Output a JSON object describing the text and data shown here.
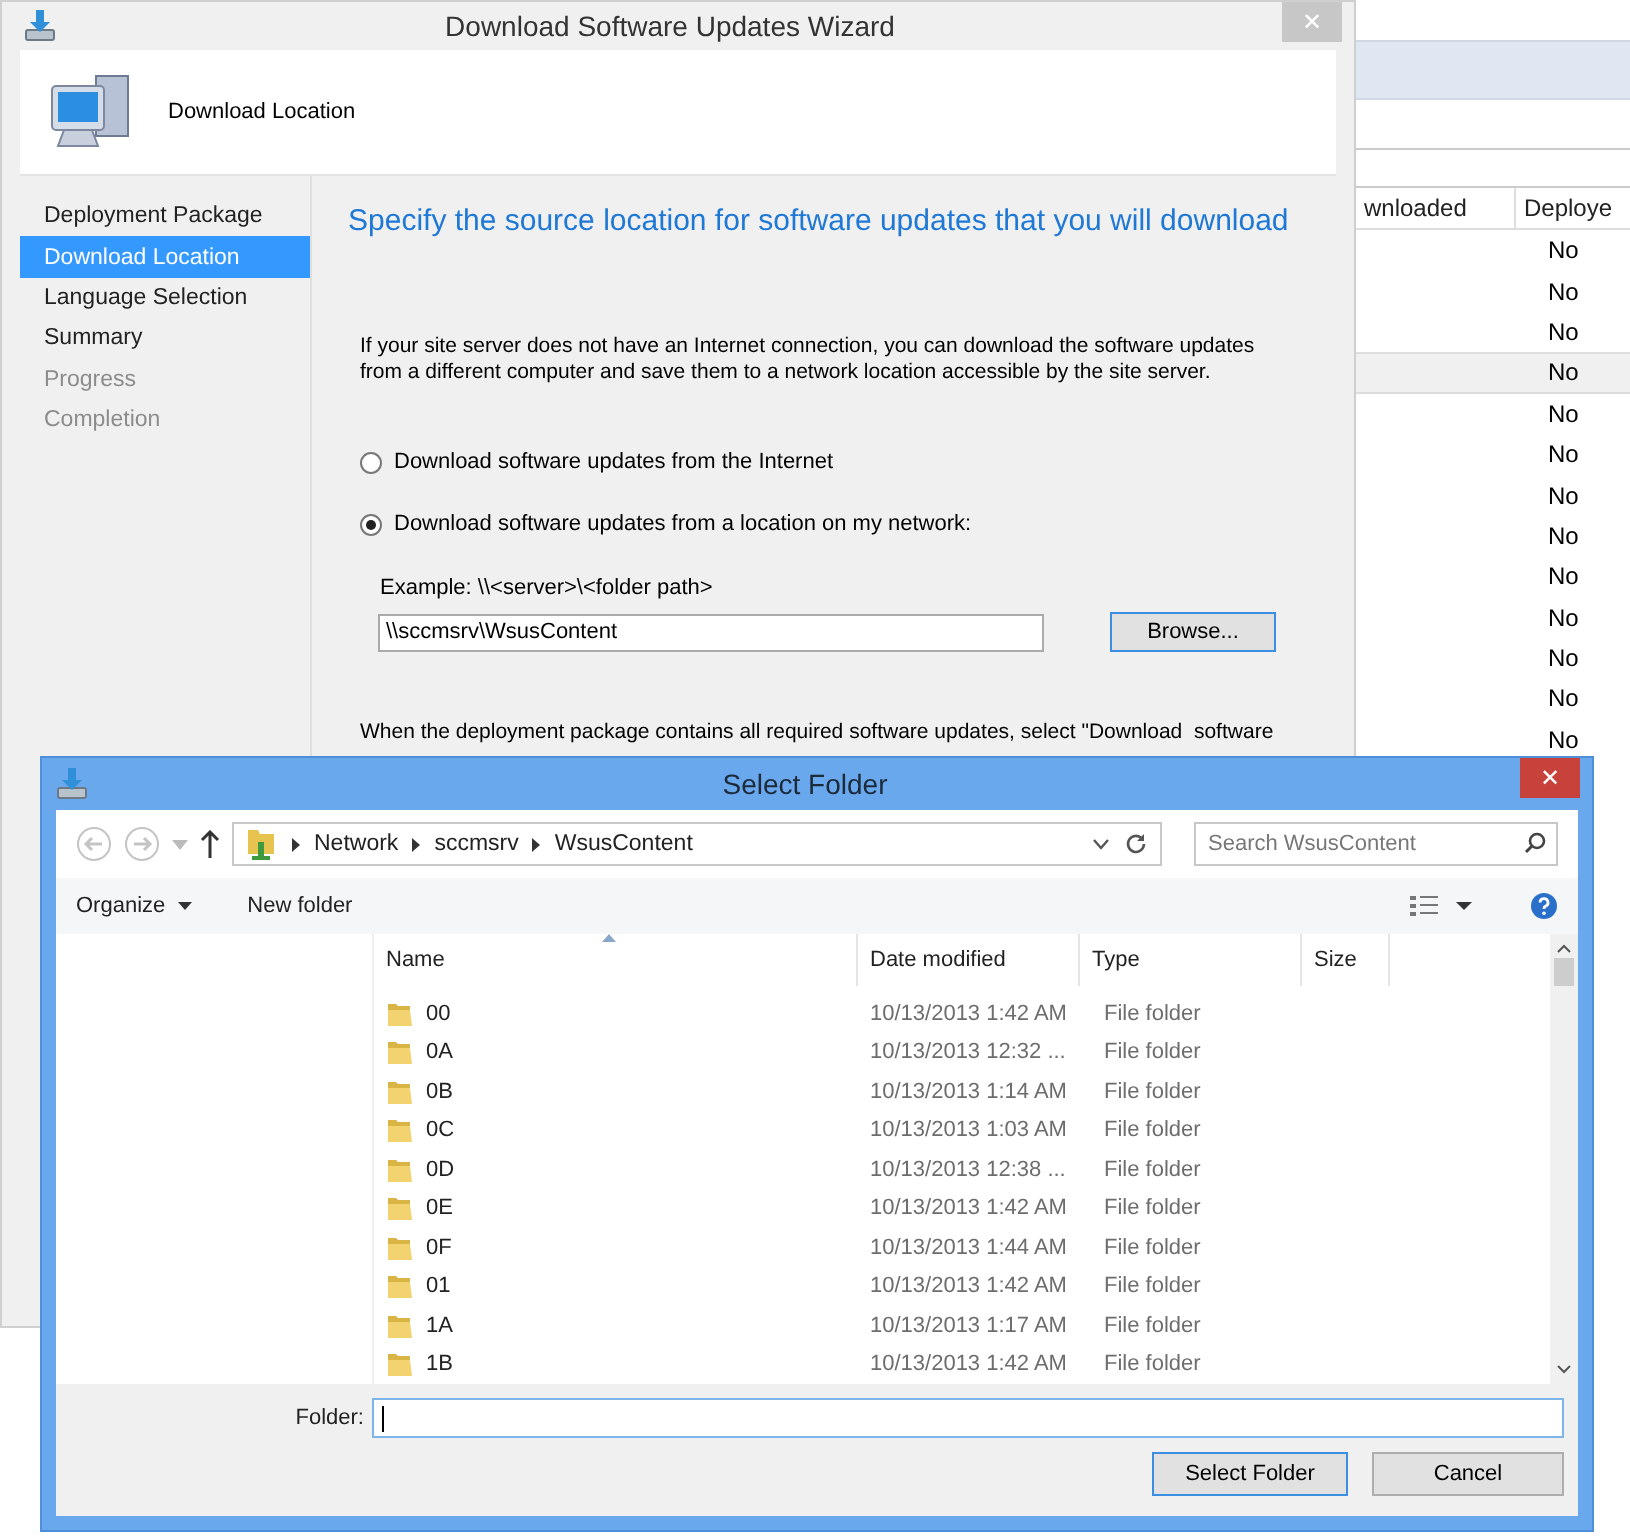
{
  "console": {
    "columns": [
      "wnloaded",
      "Deploye"
    ],
    "rows": [
      {
        "deployed": "No",
        "selected": false
      },
      {
        "deployed": "No",
        "selected": false
      },
      {
        "deployed": "No",
        "selected": false
      },
      {
        "deployed": "No",
        "selected": true
      },
      {
        "deployed": "No",
        "selected": false
      },
      {
        "deployed": "No",
        "selected": false
      },
      {
        "deployed": "No",
        "selected": false
      },
      {
        "deployed": "No",
        "selected": false
      },
      {
        "deployed": "No",
        "selected": false
      },
      {
        "deployed": "No",
        "selected": false
      },
      {
        "deployed": "No",
        "selected": false
      },
      {
        "deployed": "No",
        "selected": false
      },
      {
        "deployed": "No",
        "selected": false
      }
    ]
  },
  "wizard": {
    "title": "Download Software Updates Wizard",
    "close": "✕",
    "page_title": "Download Location",
    "nav": [
      {
        "label": "Deployment Package",
        "selected": false,
        "disabled": false
      },
      {
        "label": "Download Location",
        "selected": true,
        "disabled": false
      },
      {
        "label": "Language Selection",
        "selected": false,
        "disabled": false
      },
      {
        "label": "Summary",
        "selected": false,
        "disabled": false
      },
      {
        "label": "Progress",
        "selected": false,
        "disabled": true
      },
      {
        "label": "Completion",
        "selected": false,
        "disabled": true
      }
    ],
    "heading": "Specify the source location for software updates that you will download",
    "intro": "If your site server does not have an Internet connection, you can download the software updates from a different computer and save them to a network location accessible by the site server.",
    "options": [
      {
        "label": "Download software updates from the Internet",
        "selected": false
      },
      {
        "label": "Download software updates from a location on my network:",
        "selected": true
      }
    ],
    "example": "Example: \\\\<server>\\<folder path>",
    "path": {
      "value": "\\\\sccmsrv\\WsusContent"
    },
    "browse": "Browse...",
    "note": "When the deployment package contains all required software updates, select \"Download  software"
  },
  "dialog": {
    "title": "Select Folder",
    "close": "✕",
    "breadcrumb": [
      "Network",
      "sccmsrv",
      "WsusContent"
    ],
    "search": {
      "placeholder": "Search WsusContent"
    },
    "toolbar": {
      "organize": "Organize",
      "new_folder": "New folder"
    },
    "columns": [
      "Name",
      "Date modified",
      "Type",
      "Size"
    ],
    "files": [
      {
        "name": "00",
        "date": "10/13/2013 1:42 AM",
        "type": "File folder"
      },
      {
        "name": "0A",
        "date": "10/13/2013 12:32 ...",
        "type": "File folder"
      },
      {
        "name": "0B",
        "date": "10/13/2013 1:14 AM",
        "type": "File folder"
      },
      {
        "name": "0C",
        "date": "10/13/2013 1:03 AM",
        "type": "File folder"
      },
      {
        "name": "0D",
        "date": "10/13/2013 12:38 ...",
        "type": "File folder"
      },
      {
        "name": "0E",
        "date": "10/13/2013 1:42 AM",
        "type": "File folder"
      },
      {
        "name": "0F",
        "date": "10/13/2013 1:44 AM",
        "type": "File folder"
      },
      {
        "name": "01",
        "date": "10/13/2013 1:42 AM",
        "type": "File folder"
      },
      {
        "name": "1A",
        "date": "10/13/2013 1:17 AM",
        "type": "File folder"
      },
      {
        "name": "1B",
        "date": "10/13/2013 1:42 AM",
        "type": "File folder"
      }
    ],
    "folder_label": "Folder:",
    "buttons": [
      "Select Folder",
      "Cancel"
    ]
  }
}
